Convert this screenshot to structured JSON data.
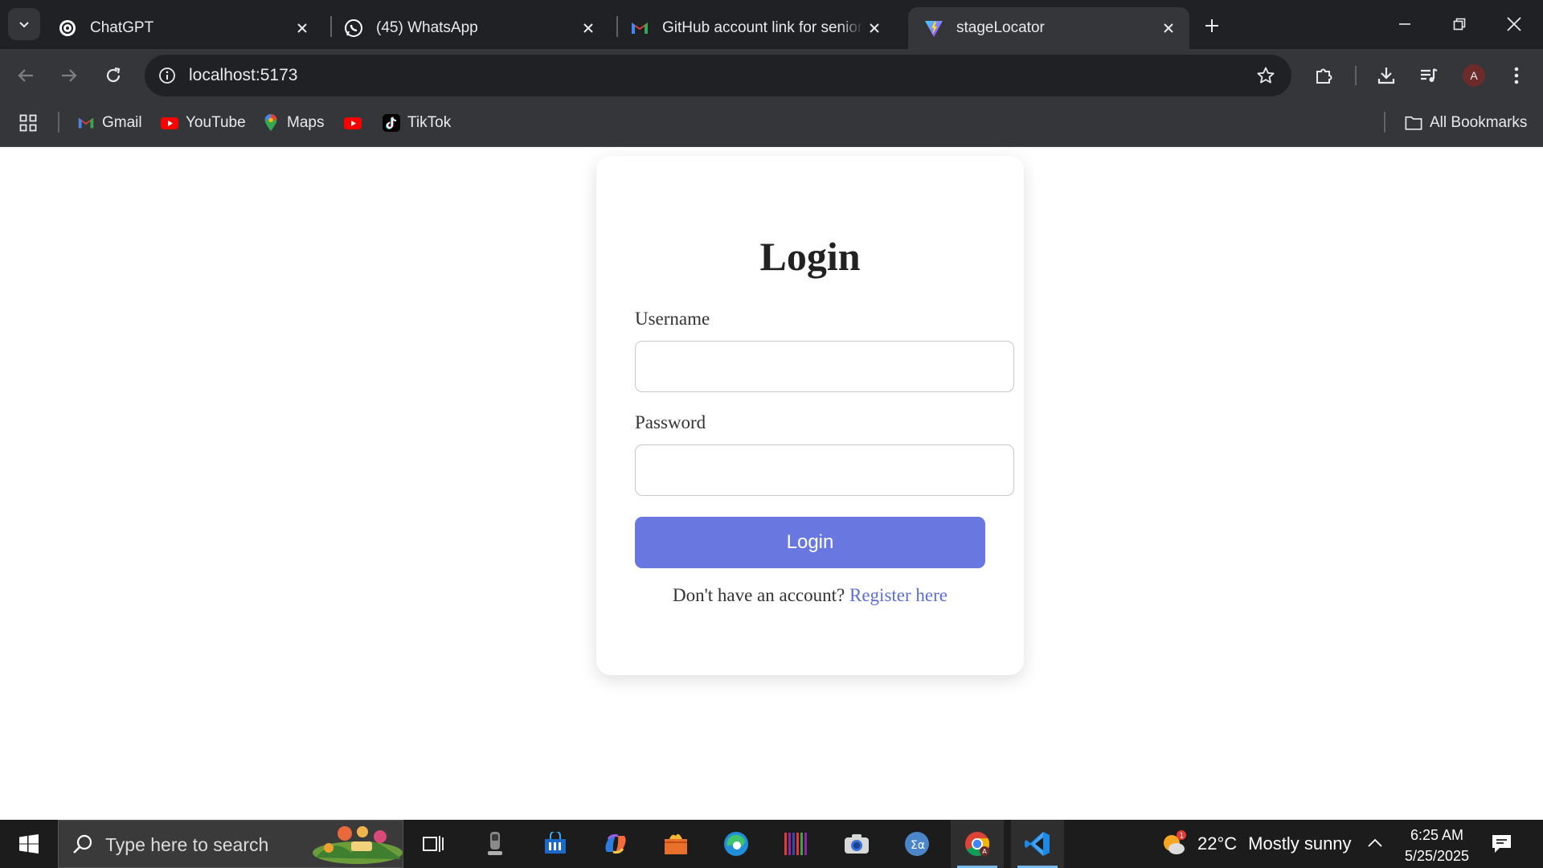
{
  "browser": {
    "tabs": [
      {
        "title": "ChatGPT",
        "icon": "chatgpt-icon"
      },
      {
        "title": "(45) WhatsApp",
        "icon": "whatsapp-icon"
      },
      {
        "title": "GitHub account link for senior p",
        "icon": "gmail-icon"
      },
      {
        "title": "stageLocator",
        "icon": "vite-icon",
        "active": true
      }
    ],
    "url": "localhost:5173",
    "profile_initial": "A",
    "bookmarks": [
      {
        "label": "Gmail",
        "icon": "gmail-icon"
      },
      {
        "label": "YouTube",
        "icon": "youtube-icon"
      },
      {
        "label": "Maps",
        "icon": "maps-icon"
      },
      {
        "label": "",
        "icon": "youtube-icon"
      },
      {
        "label": "TikTok",
        "icon": "tiktok-icon"
      }
    ],
    "all_bookmarks_label": "All Bookmarks"
  },
  "login": {
    "title": "Login",
    "username_label": "Username",
    "username_value": "",
    "password_label": "Password",
    "password_value": "",
    "submit_label": "Login",
    "register_prompt": "Don't have an account?",
    "register_link": "Register here",
    "accent_color": "#6878e0"
  },
  "taskbar": {
    "search_placeholder": "Type here to search",
    "weather_badge": "1",
    "temperature": "22°C",
    "weather": "Mostly sunny",
    "time": "6:25 AM",
    "date": "5/25/2025"
  }
}
